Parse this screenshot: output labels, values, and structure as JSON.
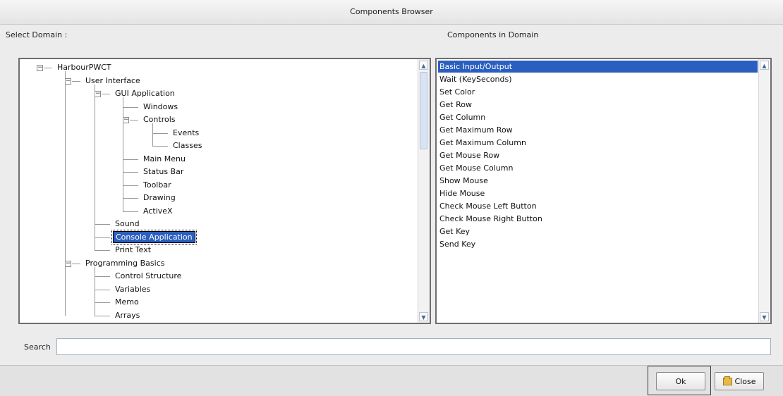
{
  "window": {
    "title": "Components Browser"
  },
  "labels": {
    "select_domain": "Select Domain :",
    "components_in_domain": "Components in Domain",
    "search": "Search"
  },
  "tree": {
    "nodes": [
      {
        "label": "HarbourPWCT",
        "depth": 0,
        "toggle": "−"
      },
      {
        "label": "User Interface",
        "depth": 1,
        "toggle": "−"
      },
      {
        "label": "GUI Application",
        "depth": 2,
        "toggle": "−"
      },
      {
        "label": "Windows",
        "depth": 3
      },
      {
        "label": "Controls",
        "depth": 3,
        "toggle": "−"
      },
      {
        "label": "Events",
        "depth": 4
      },
      {
        "label": "Classes",
        "depth": 4
      },
      {
        "label": "Main Menu",
        "depth": 3
      },
      {
        "label": "Status Bar",
        "depth": 3
      },
      {
        "label": "Toolbar",
        "depth": 3
      },
      {
        "label": "Drawing",
        "depth": 3
      },
      {
        "label": "ActiveX",
        "depth": 3
      },
      {
        "label": "Sound",
        "depth": 2
      },
      {
        "label": "Console Application",
        "depth": 2,
        "selected": true
      },
      {
        "label": "Print Text",
        "depth": 2
      },
      {
        "label": "Programming Basics",
        "depth": 1,
        "toggle": "−"
      },
      {
        "label": "Control Structure",
        "depth": 2
      },
      {
        "label": "Variables",
        "depth": 2
      },
      {
        "label": "Memo",
        "depth": 2
      },
      {
        "label": "Arrays",
        "depth": 2
      }
    ]
  },
  "components": {
    "items": [
      "Basic Input/Output",
      "Wait (KeySeconds)",
      "Set Color",
      "Get Row",
      "Get Column",
      "Get Maximum Row",
      "Get Maximum Column",
      "Get Mouse Row",
      "Get Mouse Column",
      "Show Mouse",
      "Hide Mouse",
      "Check Mouse Left Button",
      "Check Mouse Right Button",
      "Get Key",
      "Send Key"
    ],
    "selected_index": 0
  },
  "search": {
    "value": "",
    "placeholder": ""
  },
  "buttons": {
    "ok": "Ok",
    "close": "Close"
  },
  "icons": {
    "scroll_up": "chevron-up-icon",
    "scroll_down": "chevron-down-icon",
    "close": "folder-icon"
  },
  "colors": {
    "selection": "#2b5fbf"
  }
}
